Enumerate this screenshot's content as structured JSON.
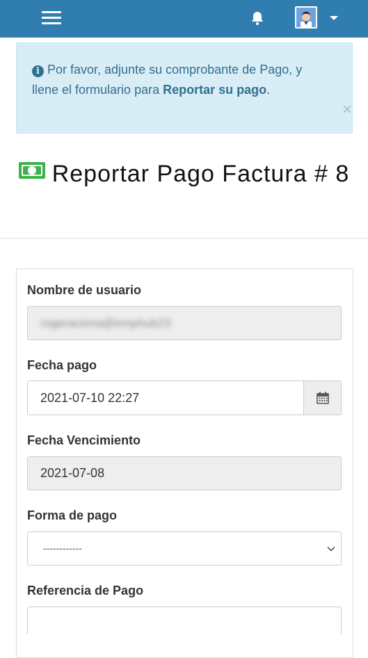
{
  "topbar": {
    "menu_icon": "hamburger-icon",
    "bell_icon": "bell-icon",
    "avatar_icon": "user-avatar",
    "caret_icon": "caret-down-icon",
    "color": "#2f7eaf"
  },
  "alert": {
    "icon": "info-circle-icon",
    "text_before": "Por favor, adjunte su comprobante de Pago, y llene el formulario para ",
    "bold_text": "Reportar su pago",
    "text_after": ".",
    "close_label": "×",
    "color_bg": "#d9edf7",
    "color_text": "#31708f"
  },
  "page": {
    "title_icon": "money-bill-icon",
    "title": "Reportar Pago Factura # 8"
  },
  "form": {
    "username_label": "Nombre de usuario",
    "username_value": "rogeraciona@emphub23",
    "fecha_pago_label": "Fecha pago",
    "fecha_pago_value": "2021-07-10 22:27",
    "calendar_icon": "calendar-icon",
    "fecha_venc_label": "Fecha Vencimiento",
    "fecha_venc_value": "2021-07-08",
    "forma_pago_label": "Forma de pago",
    "forma_pago_selected": "------------",
    "referencia_label": "Referencia de Pago",
    "referencia_value": ""
  }
}
